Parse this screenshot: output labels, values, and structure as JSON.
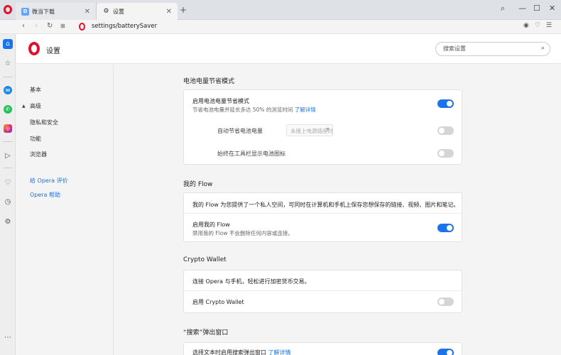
{
  "tabs": [
    {
      "label": "微当下载",
      "icon": "D"
    },
    {
      "label": "设置",
      "icon": "gear-icon"
    }
  ],
  "address": {
    "url": "settings/batterySaver"
  },
  "settings": {
    "title": "设置",
    "search_placeholder": "搜索设置"
  },
  "nav": {
    "basic": "基本",
    "advanced": "高级",
    "privacy": "隐私和安全",
    "features": "功能",
    "browser": "浏览器",
    "rate": "给 Opera 评价",
    "help": "Opera 帮助"
  },
  "battery": {
    "title": "电池电量节省模式",
    "enable_label": "启用电池电量节省模式",
    "enable_desc": "节省电池电量并延长多达 50% 的浏览时间",
    "learn_more": "了解详情",
    "auto_label": "自动节省电池电量",
    "auto_select": "未接上电源插座时",
    "icon_label": "始终在工具栏显示电池图标",
    "enable_on": true,
    "auto_on": false,
    "icon_on": false
  },
  "flow": {
    "title": "我的 Flow",
    "description": "我的 Flow 为您提供了一个私人空间，可同时在计算机和手机上保存您想保存的链接、视频、图片和笔记。",
    "enable_label": "启用我的 Flow",
    "enable_desc": "禁用我的 Flow 不会删除任何内容或连接。",
    "enable_on": true
  },
  "crypto": {
    "title": "Crypto Wallet",
    "description": "连接 Opera 与手机，轻松进行加密货币交易。",
    "enable_label": "启用 Crypto Wallet",
    "enable_on": false
  },
  "search_popup": {
    "title": "“搜索”弹出窗口",
    "enable_label": "选择文本时启用搜索弹出窗口",
    "learn_more": "了解详情",
    "enable_on": true
  },
  "colors": {
    "accent": "#1a73e8",
    "opera_red": "#e1112c"
  }
}
